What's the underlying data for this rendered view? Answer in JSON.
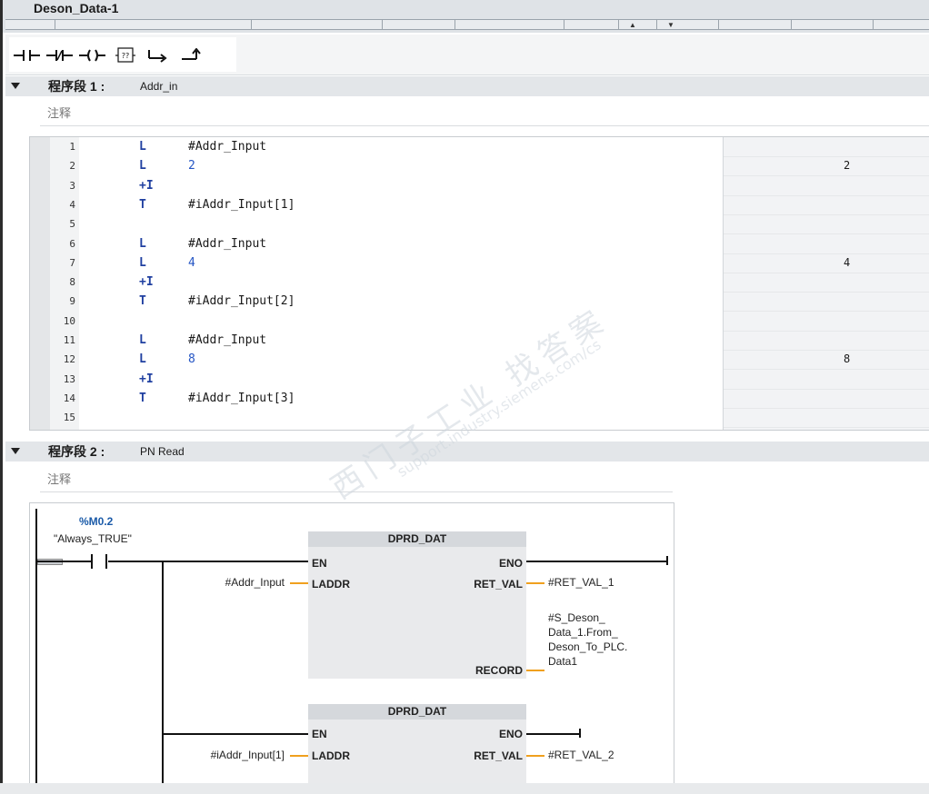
{
  "editor": {
    "title": "Deson_Data-1"
  },
  "toolbar": {
    "buttons": [
      {
        "icon": "normally-open-contact-icon"
      },
      {
        "icon": "normally-closed-contact-icon"
      },
      {
        "icon": "coil-icon"
      },
      {
        "icon": "empty-box-icon",
        "glyph": "??"
      },
      {
        "icon": "open-branch-icon"
      },
      {
        "icon": "close-branch-icon"
      }
    ]
  },
  "networks": [
    {
      "number": "程序段 1 :",
      "name": "Addr_in",
      "comment_placeholder": "注释",
      "lines": [
        {
          "n": "1",
          "op": "L",
          "arg": "#Addr_Input",
          "value": ""
        },
        {
          "n": "2",
          "op": "L",
          "arg": "2",
          "value": "2"
        },
        {
          "n": "3",
          "op": "+I",
          "arg": "",
          "value": ""
        },
        {
          "n": "4",
          "op": "T",
          "arg": "#iAddr_Input[1]",
          "value": ""
        },
        {
          "n": "5",
          "op": "",
          "arg": "",
          "value": ""
        },
        {
          "n": "6",
          "op": "L",
          "arg": "#Addr_Input",
          "value": ""
        },
        {
          "n": "7",
          "op": "L",
          "arg": "4",
          "value": "4"
        },
        {
          "n": "8",
          "op": "+I",
          "arg": "",
          "value": ""
        },
        {
          "n": "9",
          "op": "T",
          "arg": "#iAddr_Input[2]",
          "value": ""
        },
        {
          "n": "10",
          "op": "",
          "arg": "",
          "value": ""
        },
        {
          "n": "11",
          "op": "L",
          "arg": "#Addr_Input",
          "value": ""
        },
        {
          "n": "12",
          "op": "L",
          "arg": "8",
          "value": "8"
        },
        {
          "n": "13",
          "op": "+I",
          "arg": "",
          "value": ""
        },
        {
          "n": "14",
          "op": "T",
          "arg": "#iAddr_Input[3]",
          "value": ""
        },
        {
          "n": "15",
          "op": "",
          "arg": "",
          "value": ""
        }
      ]
    },
    {
      "number": "程序段 2 :",
      "name": "PN Read",
      "comment_placeholder": "注释",
      "contact": {
        "address": "%M0.2",
        "symbol": "\"Always_TRUE\""
      },
      "blocks": [
        {
          "title": "DPRD_DAT",
          "pin_en": "EN",
          "pin_eno": "ENO",
          "pin_laddr": "LADDR",
          "pin_ret": "RET_VAL",
          "pin_record": "RECORD",
          "laddr_param": "#Addr_Input",
          "ret_param": "#RET_VAL_1",
          "record_param": [
            "#S_Deson_",
            "Data_1.From_",
            "Deson_To_PLC.",
            "Data1"
          ]
        },
        {
          "title": "DPRD_DAT",
          "pin_en": "EN",
          "pin_eno": "ENO",
          "pin_laddr": "LADDR",
          "pin_ret": "RET_VAL",
          "laddr_param": "#iAddr_Input[1]",
          "ret_param": "#RET_VAL_2"
        }
      ]
    }
  ],
  "watermark": {
    "line1": "西门子工业 找答案",
    "line2": "support.industry.siemens.com/cs"
  },
  "colors": {
    "header_bg": "#e3e6e9",
    "accent_wire": "#f0a01e",
    "address_blue": "#1a5aa8",
    "operator_blue": "#1f3fa0"
  }
}
